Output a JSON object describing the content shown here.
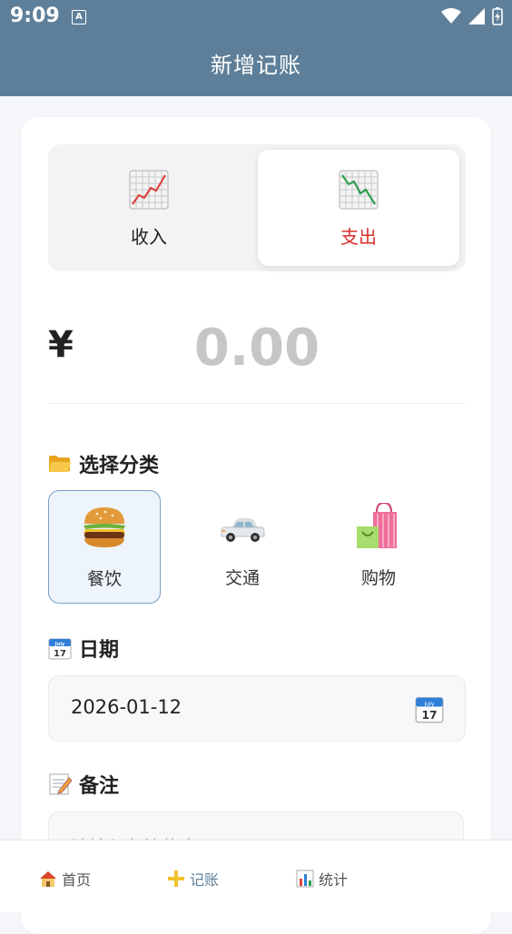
{
  "status_bar": {
    "time": "9:09",
    "notif_letter": "A"
  },
  "app_bar": {
    "title": "新增记账"
  },
  "type_switch": {
    "options": [
      {
        "label": "收入",
        "icon": "chart-increasing-icon",
        "selected": false
      },
      {
        "label": "支出",
        "icon": "chart-decreasing-icon",
        "selected": true
      }
    ]
  },
  "amount": {
    "currency": "¥",
    "value": "0.00"
  },
  "category_section": {
    "title": "选择分类",
    "items": [
      {
        "label": "餐饮",
        "icon": "hamburger-icon",
        "selected": true
      },
      {
        "label": "交通",
        "icon": "car-icon",
        "selected": false
      },
      {
        "label": "购物",
        "icon": "shopping-bags-icon",
        "selected": false
      }
    ]
  },
  "date_section": {
    "title": "日期",
    "value": "2026-01-12",
    "calendar_month": "July",
    "calendar_day": "17"
  },
  "note_section": {
    "title": "备注",
    "placeholder": "请输入备注信息"
  },
  "bottom_nav": {
    "items": [
      {
        "label": "首页",
        "icon": "house-icon"
      },
      {
        "label": "记账",
        "icon": "plus-icon",
        "active": true
      },
      {
        "label": "统计",
        "icon": "bar-chart-icon"
      }
    ]
  },
  "colors": {
    "primary": "#5e7f99",
    "expense": "#d9302f",
    "placeholder": "#c6c6c6"
  }
}
